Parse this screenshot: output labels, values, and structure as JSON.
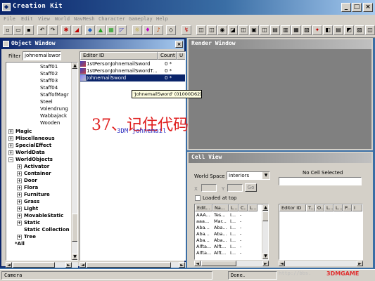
{
  "app": {
    "title": "Creation Kit"
  },
  "menu": [
    "File",
    "Edit",
    "View",
    "World",
    "NavMesh",
    "Character",
    "Gameplay",
    "Help"
  ],
  "object_window": {
    "title": "Object Window",
    "filter_label": "Filter",
    "filter_value": "johnemailsword",
    "tree": {
      "sub_items": [
        "Staff01",
        "Staff02",
        "Staff03",
        "Staff04",
        "StaffofMagr",
        "Steel",
        "Volendrung",
        "Wabbajack",
        "Wooden"
      ],
      "categories": [
        "Magic",
        "Miscellaneous",
        "SpecialEffect",
        "WorldData",
        "WorldObjects"
      ],
      "world_objects": [
        "Activator",
        "Container",
        "Door",
        "Flora",
        "Furniture",
        "Grass",
        "Light",
        "MovableStatic",
        "Static",
        "Static Collection",
        "Tree"
      ],
      "all": "*All"
    },
    "list": {
      "columns": [
        "Editor ID",
        "Count",
        "U"
      ],
      "rows": [
        {
          "id": "1stPersonJohnemailSword",
          "count": "0 *"
        },
        {
          "id": "1stPersonJohnemailSwordT...",
          "count": "0 *"
        },
        {
          "id": "JohnemailSword",
          "count": "0 *"
        }
      ]
    },
    "tooltip": "'JohnemailSword' (01000D62)"
  },
  "render_window": {
    "title": "Render Window"
  },
  "cell_view": {
    "title": "Cell View",
    "world_space_label": "World Space",
    "world_space_value": "Interiors",
    "x_label": "X",
    "y_label": "Y",
    "go_label": "Go",
    "loaded_at_top_label": "Loaded at top",
    "no_cell_label": "No Cell Selected",
    "left_columns": [
      "Edit...",
      "Na...",
      "L...",
      "C...",
      "L..."
    ],
    "left_rows": [
      [
        "AAA...",
        "Tes...",
        "I...",
        "-",
        ""
      ],
      [
        "aaa...",
        "Mar...",
        "I...",
        "-",
        ""
      ],
      [
        "Aba...",
        "Aba...",
        "I...",
        "-",
        ""
      ],
      [
        "Aba...",
        "Aba...",
        "I...",
        "-",
        ""
      ],
      [
        "Aba...",
        "Aba...",
        "I...",
        "-",
        ""
      ],
      [
        "Alfta...",
        "Alft...",
        "I...",
        "-",
        ""
      ],
      [
        "Alfta...",
        "Alft...",
        "I...",
        "-",
        ""
      ]
    ],
    "right_columns": [
      "Editor ID",
      "T...",
      "O...",
      "L...",
      "L...",
      "P...",
      "I"
    ]
  },
  "status_bar": {
    "left": "Camera",
    "right": "Done."
  },
  "watermarks": {
    "chinese": "37、记住代码",
    "code": "3DM johnemail",
    "site": "http://bbs.",
    "logo": "3DMGAME"
  },
  "colors": {
    "active_title": "#0a246a",
    "inactive_title": "#808080",
    "selected_row": "#0a246a",
    "chrome": "#d4d0c8"
  }
}
